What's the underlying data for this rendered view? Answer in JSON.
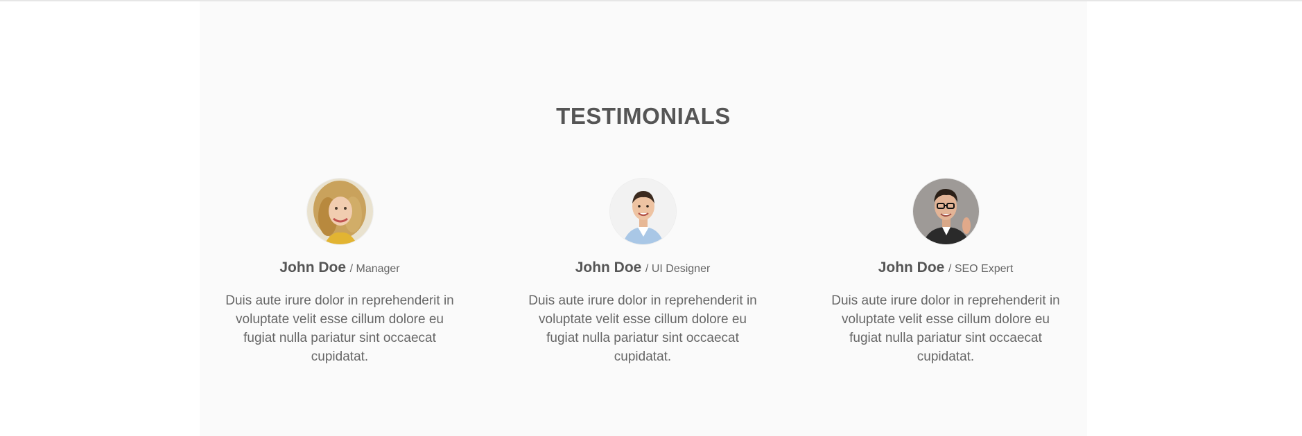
{
  "section": {
    "title": "TESTIMONIALS"
  },
  "testimonials": [
    {
      "name": "John Doe",
      "role": "/ Manager",
      "quote": "Duis aute irure dolor in reprehenderit in voluptate velit esse cillum dolore eu fugiat nulla pariatur sint occaecat cupidatat.",
      "avatar_icon": "woman-portrait-photo"
    },
    {
      "name": "John Doe",
      "role": "/ UI Designer",
      "quote": "Duis aute irure dolor in reprehenderit in voluptate velit esse cillum dolore eu fugiat nulla pariatur sint occaecat cupidatat.",
      "avatar_icon": "man-portrait-photo"
    },
    {
      "name": "John Doe",
      "role": "/ SEO Expert",
      "quote": "Duis aute irure dolor in reprehenderit in voluptate velit esse cillum dolore eu fugiat nulla pariatur sint occaecat cupidatat.",
      "avatar_icon": "man-glasses-portrait-photo"
    }
  ],
  "colors": {
    "section_bg": "#fafafa",
    "heading": "#555555",
    "body_text": "#666666"
  }
}
